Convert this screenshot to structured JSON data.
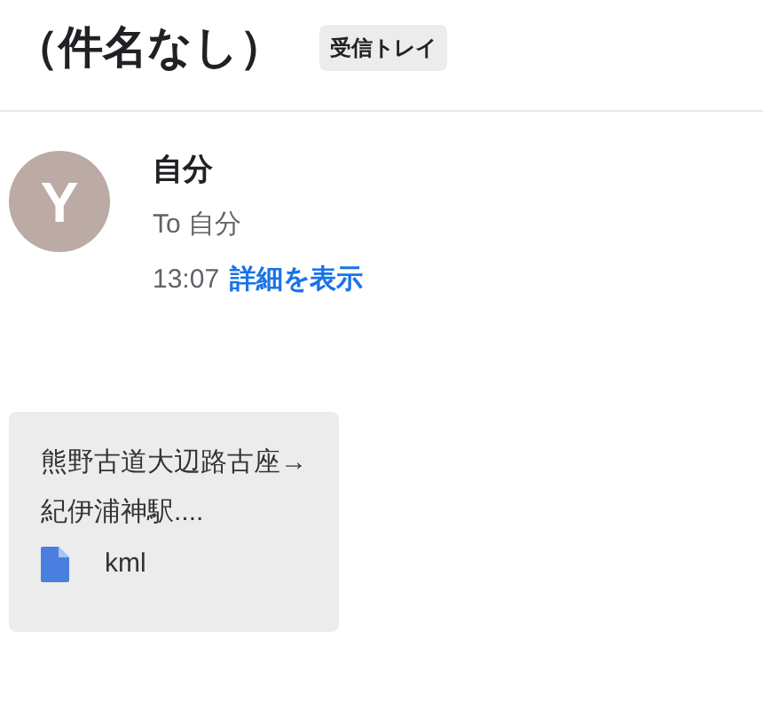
{
  "subject": "（件名なし）",
  "label": "受信トレイ",
  "message": {
    "avatar": "Y",
    "sender": "自分",
    "to": "To 自分",
    "time": "13:07",
    "details_link": "詳細を表示"
  },
  "attachment": {
    "name": "熊野古道大辺路古座→紀伊浦神駅....",
    "type": "kml"
  }
}
